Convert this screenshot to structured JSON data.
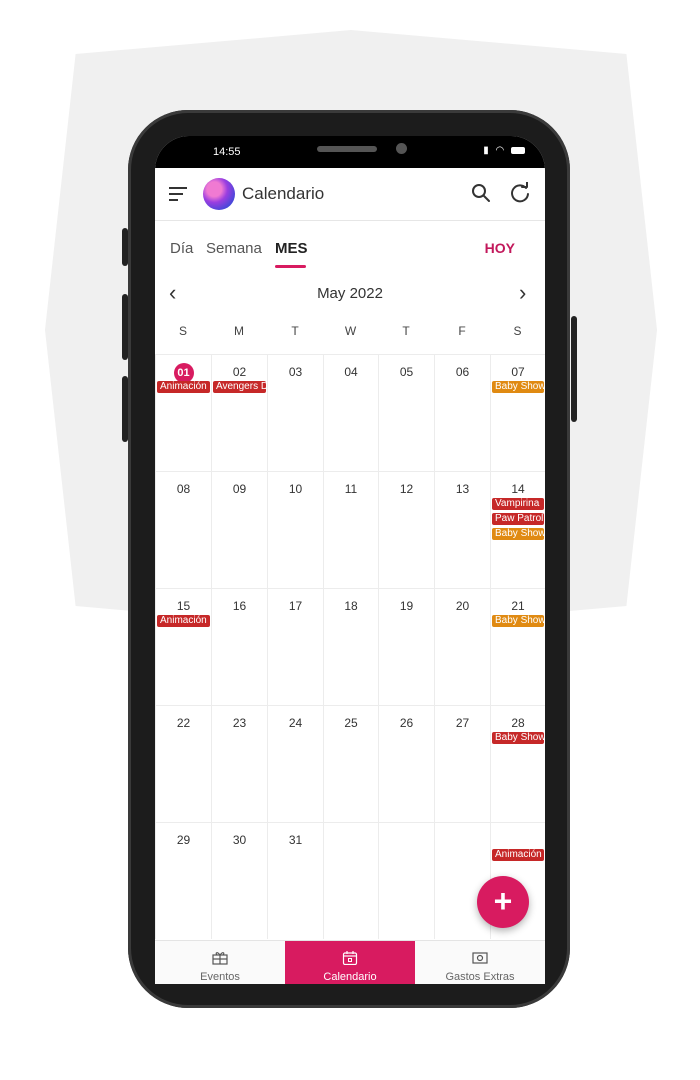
{
  "status_bar": {
    "time": "14:55",
    "icons": [
      "signal-icon",
      "wifi-icon",
      "battery-icon"
    ]
  },
  "app_bar": {
    "title": "Calendario"
  },
  "tabs": [
    {
      "label": "Día",
      "active": false
    },
    {
      "label": "Semana",
      "active": false
    },
    {
      "label": "MES",
      "active": true
    }
  ],
  "today_button": "HOY",
  "month_label": "May 2022",
  "weekdays": [
    "S",
    "M",
    "T",
    "W",
    "T",
    "F",
    "S"
  ],
  "weeks": [
    [
      {
        "day": "01",
        "today": true,
        "events": [
          {
            "title": "Animación",
            "color": "#c62828"
          }
        ]
      },
      {
        "day": "02",
        "events": [
          {
            "title": "Avengers D",
            "color": "#c62828"
          }
        ]
      },
      {
        "day": "03",
        "events": []
      },
      {
        "day": "04",
        "events": []
      },
      {
        "day": "05",
        "events": []
      },
      {
        "day": "06",
        "events": []
      },
      {
        "day": "07",
        "events": [
          {
            "title": "Baby Show",
            "color": "#e08a12"
          }
        ]
      }
    ],
    [
      {
        "day": "08",
        "events": []
      },
      {
        "day": "09",
        "events": []
      },
      {
        "day": "10",
        "events": []
      },
      {
        "day": "11",
        "events": []
      },
      {
        "day": "12",
        "events": []
      },
      {
        "day": "13",
        "events": []
      },
      {
        "day": "14",
        "events": [
          {
            "title": "Vampirina",
            "color": "#c62828"
          },
          {
            "title": "Paw Patrol",
            "color": "#c62828"
          },
          {
            "title": "Baby Show",
            "color": "#e08a12"
          }
        ]
      }
    ],
    [
      {
        "day": "15",
        "events": [
          {
            "title": "Animación",
            "color": "#c62828"
          }
        ]
      },
      {
        "day": "16",
        "events": []
      },
      {
        "day": "17",
        "events": []
      },
      {
        "day": "18",
        "events": []
      },
      {
        "day": "19",
        "events": []
      },
      {
        "day": "20",
        "events": []
      },
      {
        "day": "21",
        "events": [
          {
            "title": "Baby Show",
            "color": "#e08a12"
          }
        ]
      }
    ],
    [
      {
        "day": "22",
        "events": []
      },
      {
        "day": "23",
        "events": []
      },
      {
        "day": "24",
        "events": []
      },
      {
        "day": "25",
        "events": []
      },
      {
        "day": "26",
        "events": []
      },
      {
        "day": "27",
        "events": []
      },
      {
        "day": "28",
        "events": [
          {
            "title": "Baby Show",
            "color": "#c62828"
          }
        ]
      }
    ],
    [
      {
        "day": "29",
        "events": []
      },
      {
        "day": "30",
        "events": []
      },
      {
        "day": "31",
        "events": []
      },
      {
        "day": "",
        "events": []
      },
      {
        "day": "",
        "events": []
      },
      {
        "day": "",
        "events": []
      },
      {
        "day": "",
        "events": [
          {
            "title": "Animación",
            "color": "#c62828"
          }
        ]
      }
    ]
  ],
  "fab_label": "+",
  "bottom_nav": [
    {
      "label": "Eventos",
      "icon": "gift-icon",
      "active": false
    },
    {
      "label": "Calendario",
      "icon": "calendar-icon",
      "active": true
    },
    {
      "label": "Gastos Extras",
      "icon": "money-icon",
      "active": false
    }
  ],
  "colors": {
    "accent": "#d81b60",
    "event_red": "#c62828",
    "event_orange": "#e08a12"
  }
}
